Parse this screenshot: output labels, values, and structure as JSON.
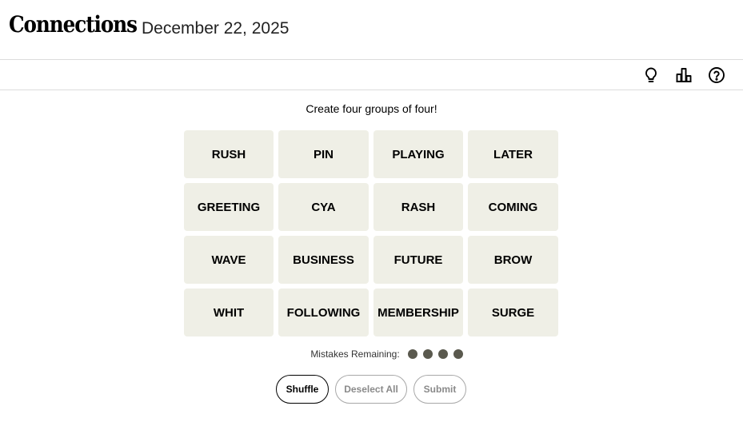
{
  "header": {
    "title": "Connections",
    "date": "December 22, 2025"
  },
  "toolbar": {
    "icons": [
      "lightbulb-icon",
      "bar-chart-icon",
      "help-icon"
    ]
  },
  "prompt": "Create four groups of four!",
  "tiles": [
    "RUSH",
    "PIN",
    "PLAYING",
    "LATER",
    "GREETING",
    "CYA",
    "RASH",
    "COMING",
    "WAVE",
    "BUSINESS",
    "FUTURE",
    "BROW",
    "WHIT",
    "FOLLOWING",
    "MEMBERSHIP",
    "SURGE"
  ],
  "mistakes": {
    "label": "Mistakes Remaining:",
    "remaining": 4
  },
  "actions": {
    "shuffle": "Shuffle",
    "deselect": "Deselect All",
    "submit": "Submit"
  },
  "colors": {
    "tile_bg": "#efefe6",
    "dot": "#5a594e"
  }
}
